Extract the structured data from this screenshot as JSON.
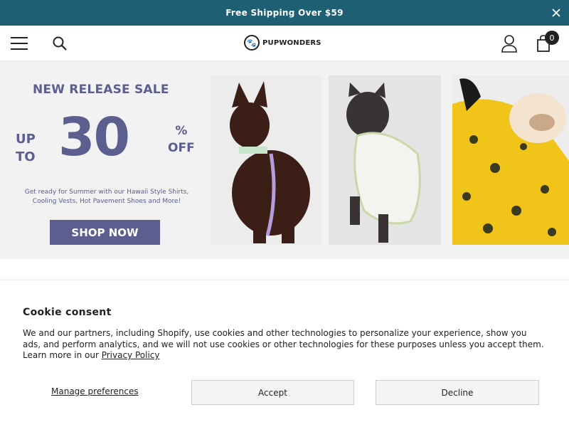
{
  "announcement": {
    "text": "Free Shipping Over $59",
    "close_icon": "close-icon"
  },
  "header": {
    "logo_text": "PUPWONDERS",
    "cart_count": "0",
    "icons": [
      "menu-icon",
      "search-icon",
      "account-icon",
      "cart-icon"
    ]
  },
  "banner": {
    "heading": "NEW RELEASE SALE",
    "up": "UP",
    "to": "TO",
    "big_number": "30",
    "percent": "%",
    "off": "OFF",
    "sub_line1": "Get ready for Summer with our Hawaii Style Shirts,",
    "sub_line2": "Cooling Vests, Hot Pavement Shoes and More!",
    "cta": "SHOP NOW"
  },
  "cookie": {
    "title": "Cookie consent",
    "body": "We and our partners, including Shopify, use cookies and other technologies to personalize your experience, show you ads, and perform analytics, and we will not use cookies or other technologies for these purposes unless you accept them. Learn more in our ",
    "privacy_link": "Privacy Policy",
    "manage": "Manage preferences",
    "accept": "Accept",
    "decline": "Decline"
  },
  "colors": {
    "announce_bg": "#1e5f74",
    "promo_accent": "#5b5e8f"
  }
}
